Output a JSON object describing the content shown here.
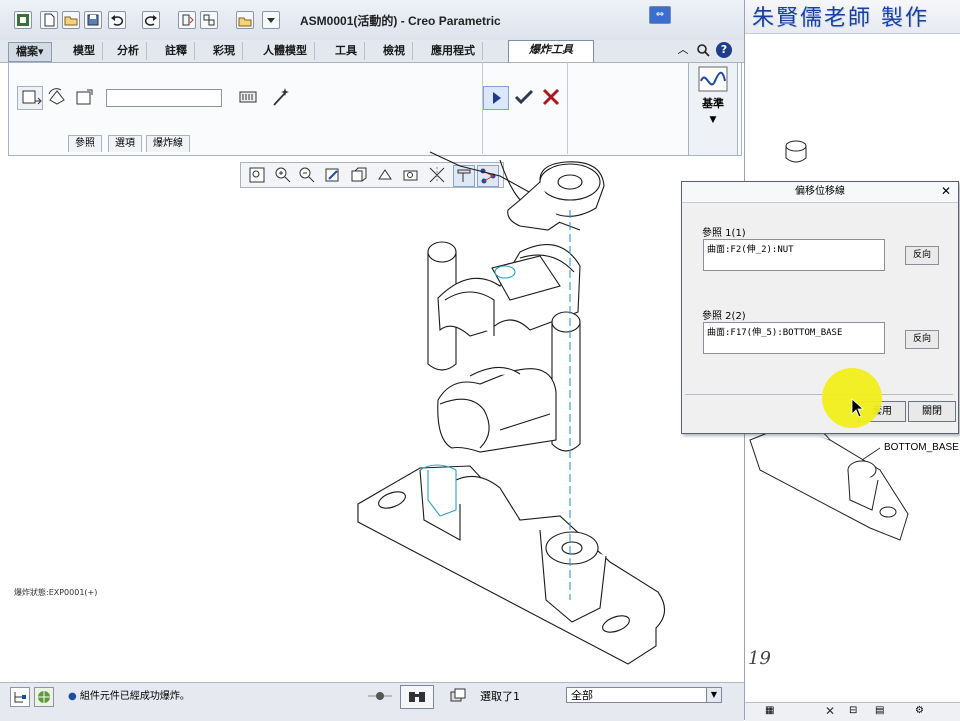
{
  "window": {
    "title": "ASM0001(活動的) - Creo Parametric",
    "restore_icon": "restore-down-icon"
  },
  "tabs": [
    {
      "label": "檔案▾"
    },
    {
      "label": "模型"
    },
    {
      "label": "分析"
    },
    {
      "label": "註釋"
    },
    {
      "label": "彩現"
    },
    {
      "label": "人體模型"
    },
    {
      "label": "工具"
    },
    {
      "label": "檢視"
    },
    {
      "label": "應用程式"
    },
    {
      "label": "爆炸工具"
    }
  ],
  "ribbon": {
    "input_value": "",
    "subtabs": [
      "參照",
      "選項",
      "爆炸線"
    ],
    "kijun_label": "基準"
  },
  "graphics": {
    "model_name": "爆炸狀態:EXP0001(+)"
  },
  "status": {
    "message": "組件元件已經成功爆炸。",
    "select_count": "選取了1",
    "filter_value": "全部"
  },
  "background_window": {
    "banner": "朱賢儒老師 製作",
    "label_bottom_base": "BOTTOM_BASE",
    "page_number": "19"
  },
  "dialog": {
    "title": "偏移位移線",
    "ref1_label": "參照 1(1)",
    "ref1_value": "曲面:F2(伸_2):NUT",
    "ref2_label": "參照 2(2)",
    "ref2_value": "曲面:F17(伸_5):BOTTOM_BASE",
    "flip_label": "反向",
    "apply_label": "套用",
    "close_label": "關閉"
  },
  "colors": {
    "accent": "#3a6fd0",
    "highlight": "#f1ee1a",
    "axis_line": "#2aa0c8"
  }
}
